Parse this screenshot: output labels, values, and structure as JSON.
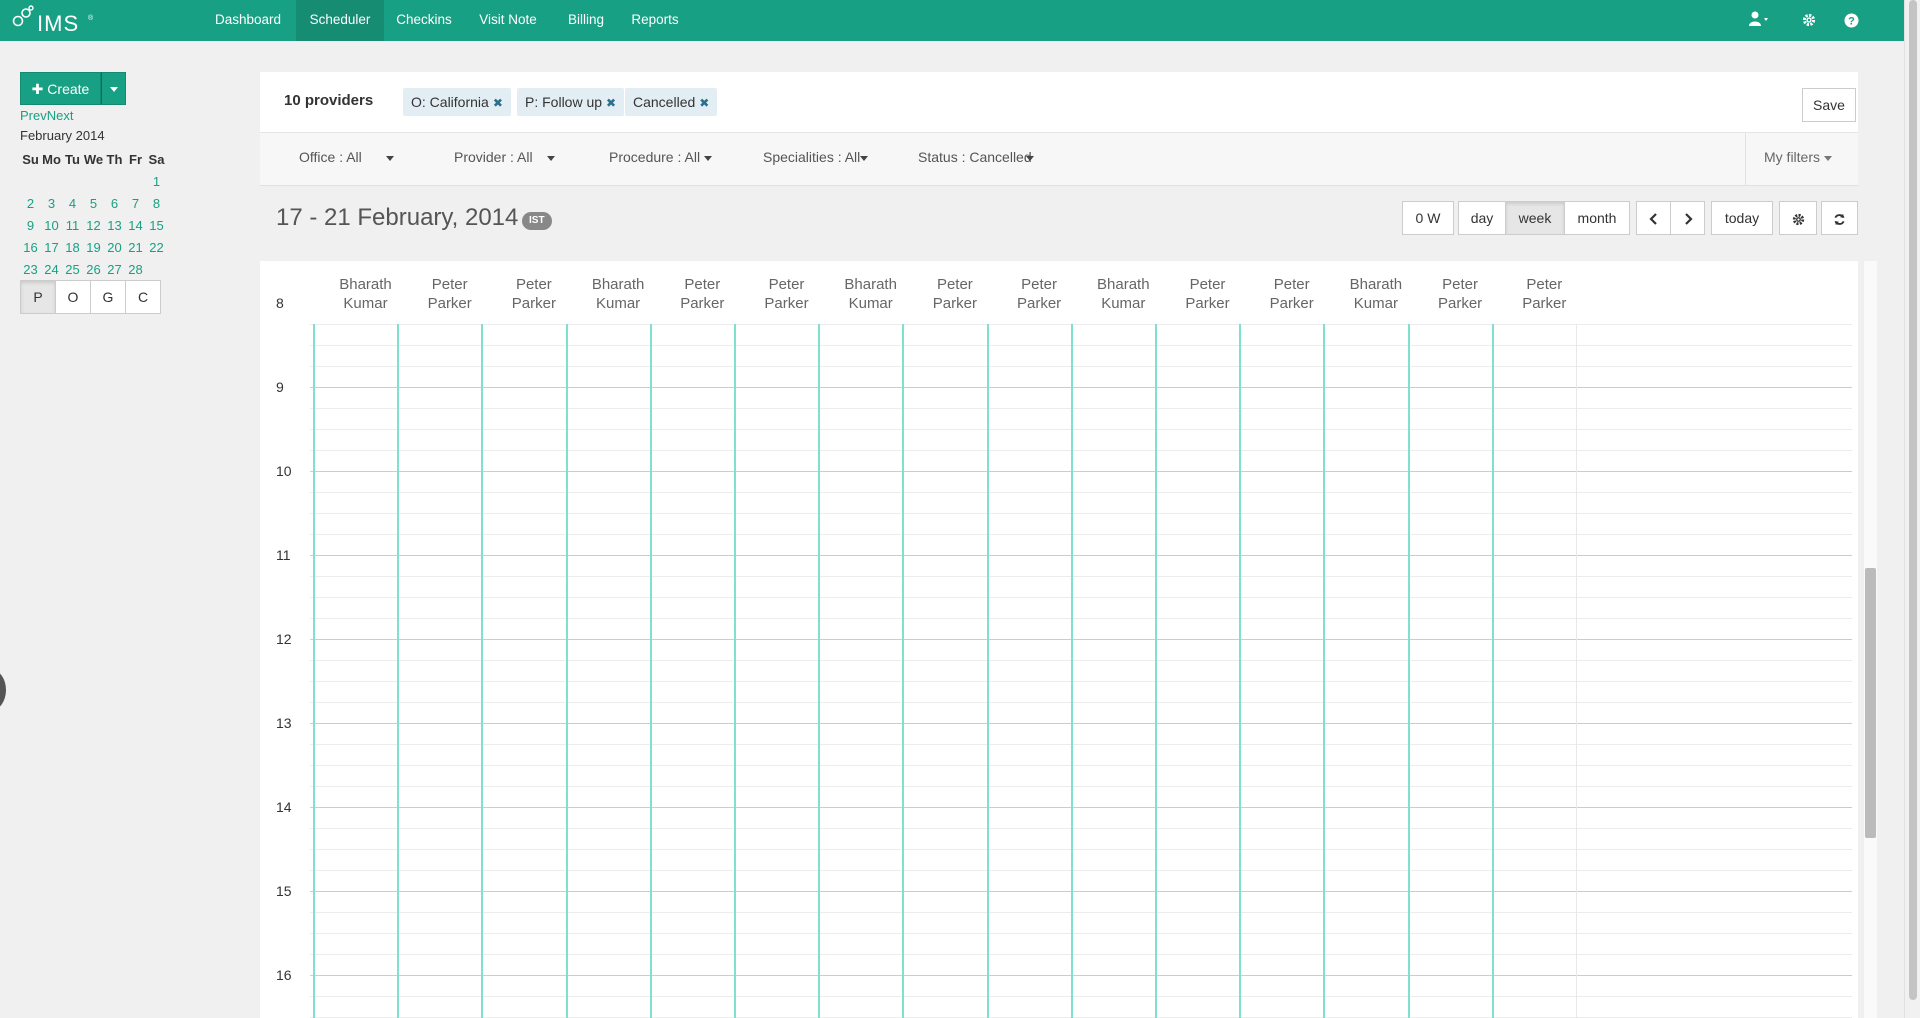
{
  "app": {
    "logo_text": "IMS",
    "logo_tm": "®"
  },
  "nav": {
    "items": [
      {
        "label": "Dashboard",
        "active": false
      },
      {
        "label": "Scheduler",
        "active": true
      },
      {
        "label": "Checkins",
        "active": false
      },
      {
        "label": "Visit Note",
        "active": false
      },
      {
        "label": "Billing",
        "active": false
      },
      {
        "label": "Reports",
        "active": false
      }
    ],
    "user_icon": "user-icon",
    "settings_icon": "gear-icon",
    "help_icon": "help-icon",
    "accent": "#18a084"
  },
  "sidebar": {
    "create_label": "✚ Create",
    "prev_label": "Prev",
    "next_label": "Next",
    "month_label": "February 2014",
    "weekdays": [
      "Su",
      "Mo",
      "Tu",
      "We",
      "Th",
      "Fr",
      "Sa"
    ],
    "weeks": [
      [
        "",
        "",
        "",
        "",
        "",
        "",
        "1"
      ],
      [
        "2",
        "3",
        "4",
        "5",
        "6",
        "7",
        "8"
      ],
      [
        "9",
        "10",
        "11",
        "12",
        "13",
        "14",
        "15"
      ],
      [
        "16",
        "17",
        "18",
        "19",
        "20",
        "21",
        "22"
      ],
      [
        "23",
        "24",
        "25",
        "26",
        "27",
        "28",
        ""
      ]
    ],
    "view_toggles": [
      "P",
      "O",
      "G",
      "C"
    ]
  },
  "filters": {
    "providers_count": "10 providers",
    "chips": [
      "O: California",
      "P: Follow up",
      "Cancelled"
    ],
    "save_label": "Save",
    "dropdowns": [
      "Office : All",
      "Provider : All",
      "Procedure : All",
      "Specialities : All",
      "Status : Cancelled"
    ],
    "my_filters_label": "My filters"
  },
  "toolbar": {
    "date_range": "17 - 21 February, 2014",
    "timezone": "IST",
    "buttons": [
      "0 W",
      "day",
      "week",
      "month"
    ],
    "active_button": "week",
    "prev_icon": "chevron-left-icon",
    "next_icon": "chevron-right-icon",
    "today_label": "today",
    "settings_icon": "gear-icon",
    "refresh_icon": "refresh-icon"
  },
  "calendar": {
    "columns": [
      [
        "Bharath",
        "Kumar"
      ],
      [
        "Peter",
        "Parker"
      ],
      [
        "Peter",
        "Parker"
      ],
      [
        "Bharath",
        "Kumar"
      ],
      [
        "Peter",
        "Parker"
      ],
      [
        "Peter",
        "Parker"
      ],
      [
        "Bharath",
        "Kumar"
      ],
      [
        "Peter",
        "Parker"
      ],
      [
        "Peter",
        "Parker"
      ],
      [
        "Bharath",
        "Kumar"
      ],
      [
        "Peter",
        "Parker"
      ],
      [
        "Peter",
        "Parker"
      ],
      [
        "Bharath",
        "Kumar"
      ],
      [
        "Peter",
        "Parker"
      ],
      [
        "Peter",
        "Parker"
      ]
    ],
    "hours": [
      "8",
      "9",
      "10",
      "11",
      "12",
      "13",
      "14",
      "15",
      "16"
    ],
    "hour_line_color": "#a6e6a6",
    "column_line_color": "#7fe0d0"
  }
}
